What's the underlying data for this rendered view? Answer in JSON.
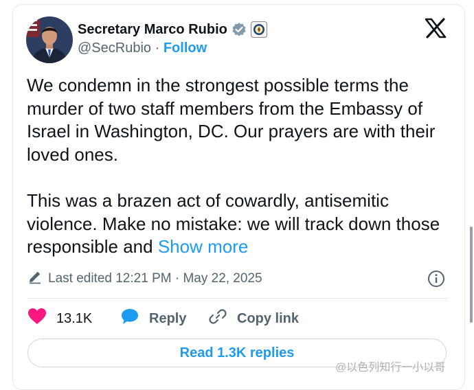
{
  "author": {
    "display_name": "Secretary Marco Rubio",
    "handle": "@SecRubio",
    "separator": "·",
    "follow_label": "Follow"
  },
  "post": {
    "paragraph1": "We condemn in the strongest possible terms the murder of two staff members from the Embassy of Israel in Washington, DC. Our prayers are with their loved ones.",
    "paragraph2": "This was a brazen act of cowardly, antisemitic violence. Make no mistake: we will track down those responsible and",
    "show_more": "Show more",
    "edited": "Last edited 12:21 PM · May 22, 2025"
  },
  "actions": {
    "likes": "13.1K",
    "reply": "Reply",
    "copy_link": "Copy link"
  },
  "replies_button": "Read 1.3K replies",
  "watermark": "@以色列知行一小以哥",
  "colors": {
    "accent": "#1d9bf0",
    "like": "#f91880",
    "text": "#0f1419",
    "muted": "#536471"
  },
  "icons": [
    "verified-badge-icon",
    "government-seal-icon",
    "x-logo-icon",
    "edit-pencil-icon",
    "info-icon",
    "heart-icon",
    "reply-bubble-icon",
    "link-icon"
  ]
}
